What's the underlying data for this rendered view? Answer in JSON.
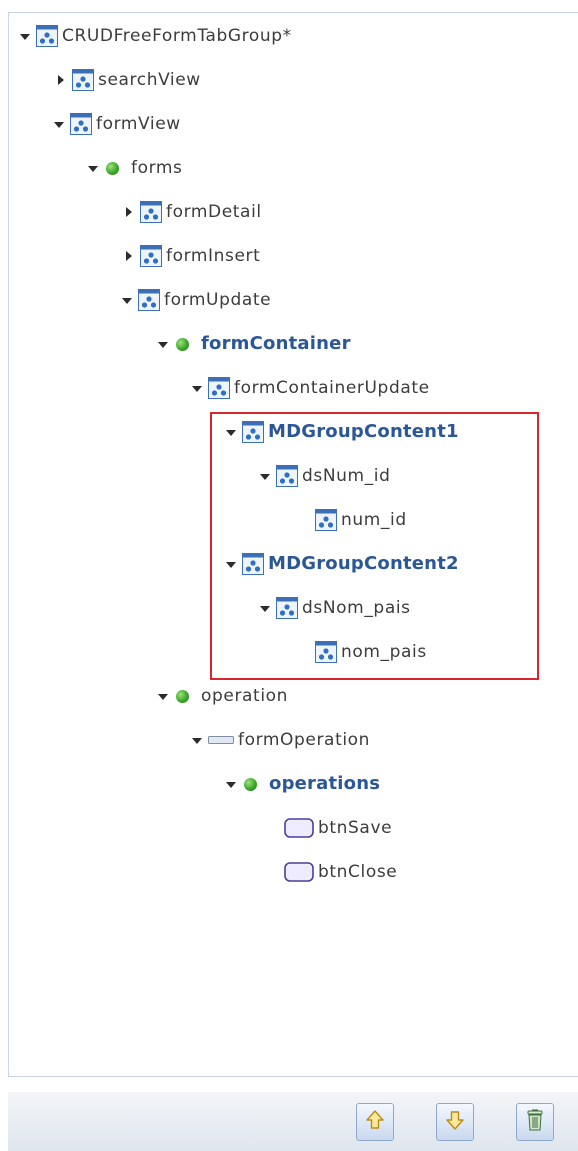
{
  "tree": {
    "nodes": [
      {
        "label": "CRUDFreeFormTabGroup*",
        "icon": "form-component-icon",
        "expander": "open"
      },
      {
        "label": "searchView",
        "icon": "form-component-icon",
        "expander": "closed"
      },
      {
        "label": "formView",
        "icon": "form-component-icon",
        "expander": "open"
      },
      {
        "label": "forms",
        "icon": "green-dot-icon",
        "expander": "open"
      },
      {
        "label": "formDetail",
        "icon": "form-component-icon",
        "expander": "closed"
      },
      {
        "label": "formInsert",
        "icon": "form-component-icon",
        "expander": "closed"
      },
      {
        "label": "formUpdate",
        "icon": "form-component-icon",
        "expander": "open"
      },
      {
        "label": "formContainer",
        "icon": "green-dot-icon",
        "expander": "open"
      },
      {
        "label": "formContainerUpdate",
        "icon": "form-component-icon",
        "expander": "open"
      },
      {
        "label": "MDGroupContent1",
        "icon": "form-component-icon",
        "expander": "open"
      },
      {
        "label": "dsNum_id",
        "icon": "form-component-icon",
        "expander": "open"
      },
      {
        "label": "num_id",
        "icon": "form-component-icon",
        "expander": "none"
      },
      {
        "label": "MDGroupContent2",
        "icon": "form-component-icon",
        "expander": "open"
      },
      {
        "label": "dsNom_pais",
        "icon": "form-component-icon",
        "expander": "open"
      },
      {
        "label": "nom_pais",
        "icon": "form-component-icon",
        "expander": "none"
      },
      {
        "label": "operation",
        "icon": "green-dot-icon",
        "expander": "open"
      },
      {
        "label": "formOperation",
        "icon": "operation-bar-icon",
        "expander": "open"
      },
      {
        "label": "operations",
        "icon": "green-dot-icon",
        "expander": "open"
      },
      {
        "label": "btnSave",
        "icon": "button-component-icon",
        "expander": "none"
      },
      {
        "label": "btnClose",
        "icon": "button-component-icon",
        "expander": "none"
      }
    ]
  },
  "toolbar": {
    "buttons": [
      {
        "icon": "arrow-up-icon"
      },
      {
        "icon": "arrow-down-icon"
      },
      {
        "icon": "trash-icon"
      }
    ]
  },
  "colors": {
    "bold_label": "#2b5796",
    "highlight_border": "#d7262e",
    "panel_border": "#c8d4e3"
  }
}
